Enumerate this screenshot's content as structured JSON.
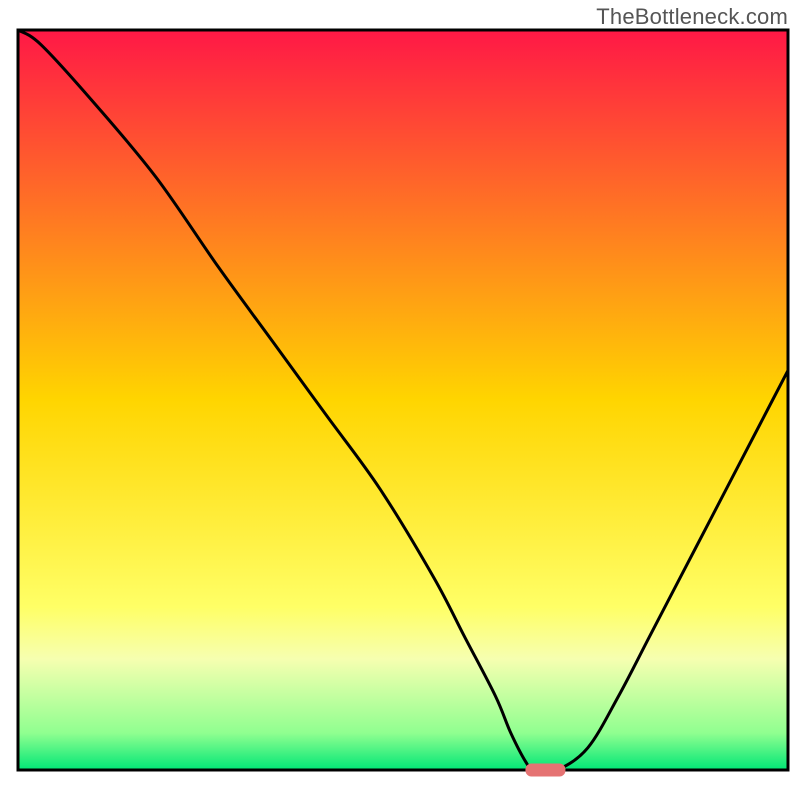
{
  "watermark": "TheBottleneck.com",
  "chart_data": {
    "type": "line",
    "title": "",
    "xlabel": "",
    "ylabel": "",
    "xlim": [
      0,
      100
    ],
    "ylim": [
      0,
      100
    ],
    "x": [
      0,
      3,
      10,
      18,
      26,
      33,
      40,
      47,
      54,
      58,
      62,
      64,
      66,
      67,
      70,
      74,
      78,
      82,
      86,
      90,
      94,
      98,
      100
    ],
    "values": [
      100,
      98,
      90,
      80,
      68,
      58,
      48,
      38,
      26,
      18,
      10,
      5,
      1,
      0,
      0,
      3,
      10,
      18,
      26,
      34,
      42,
      50,
      54
    ],
    "marker": {
      "x_center": 68.5,
      "y": 0
    },
    "gradient_stops": [
      {
        "offset": 0.0,
        "color": "#ff1846"
      },
      {
        "offset": 0.5,
        "color": "#ffd500"
      },
      {
        "offset": 0.78,
        "color": "#ffff66"
      },
      {
        "offset": 0.85,
        "color": "#f6ffb0"
      },
      {
        "offset": 0.95,
        "color": "#90ff90"
      },
      {
        "offset": 1.0,
        "color": "#00e676"
      }
    ],
    "frame_color": "#000000",
    "line_color": "#000000",
    "marker_color": "#e57373"
  }
}
